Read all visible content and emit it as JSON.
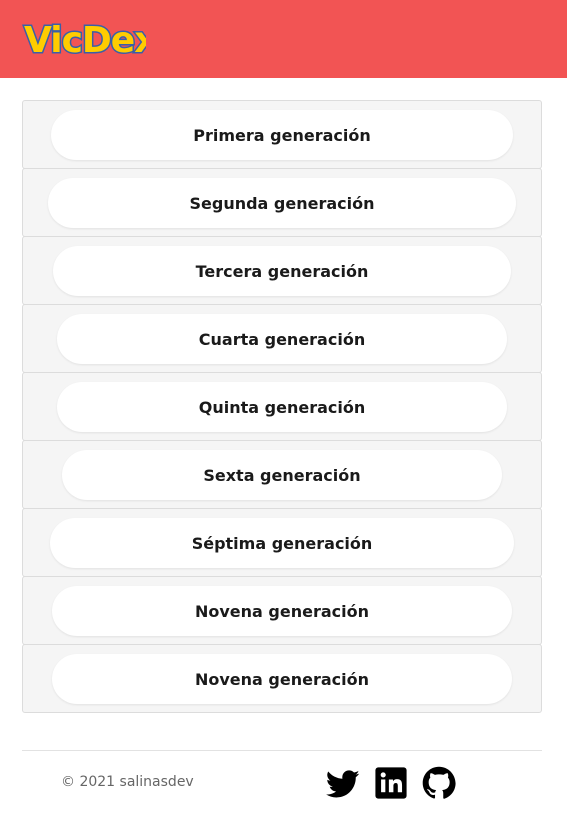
{
  "header": {
    "logo_text": "VicDex",
    "brand_color": "#f25454",
    "logo_fill": "#ffcc00",
    "logo_stroke": "#3a5fa8"
  },
  "generations": [
    {
      "label": "Primera generación"
    },
    {
      "label": "Segunda generación"
    },
    {
      "label": "Tercera generación"
    },
    {
      "label": "Cuarta generación"
    },
    {
      "label": "Quinta generación"
    },
    {
      "label": "Sexta generación"
    },
    {
      "label": "Séptima generación"
    },
    {
      "label": "Novena generación"
    },
    {
      "label": "Novena generación"
    }
  ],
  "footer": {
    "copyright": "© 2021 salinasdev",
    "social": [
      {
        "icon": "twitter-icon"
      },
      {
        "icon": "linkedin-icon"
      },
      {
        "icon": "github-icon"
      }
    ]
  }
}
